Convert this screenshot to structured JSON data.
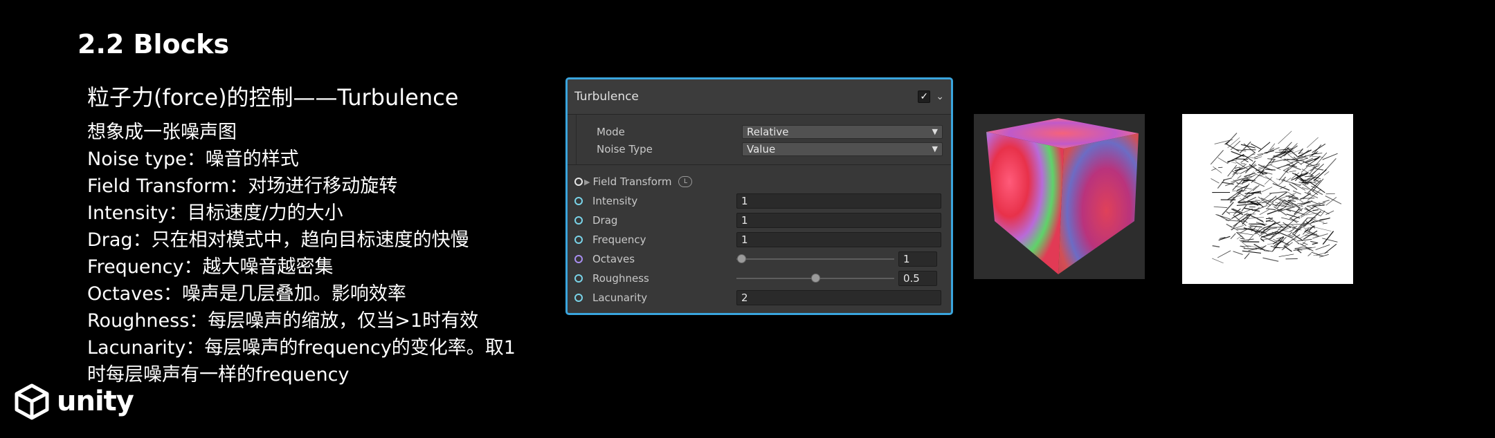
{
  "slide": {
    "title": "2.2 Blocks",
    "subtitle": "粒子力(force)的控制——Turbulence",
    "bullets": [
      "想象成一张噪声图",
      "Noise type：噪音的样式",
      "Field Transform：对场进行移动旋转",
      "Intensity：目标速度/力的大小",
      "Drag：只在相对模式中，趋向目标速度的快慢",
      "Frequency：越大噪音越密集",
      "Octaves：噪声是几层叠加。影响效率",
      "Roughness：每层噪声的缩放，仅当>1时有效",
      "Lacunarity：每层噪声的frequency的变化率。取1",
      "时每层噪声有一样的frequency"
    ],
    "logo_text": "unity"
  },
  "panel": {
    "title": "Turbulence",
    "enabled": true,
    "mode": {
      "label": "Mode",
      "value": "Relative"
    },
    "noise_type": {
      "label": "Noise Type",
      "value": "Value"
    },
    "field_transform": {
      "label": "Field Transform",
      "badge": "L"
    },
    "intensity": {
      "label": "Intensity",
      "value": "1"
    },
    "drag": {
      "label": "Drag",
      "value": "1"
    },
    "frequency": {
      "label": "Frequency",
      "value": "1"
    },
    "octaves": {
      "label": "Octaves",
      "value": "1",
      "slider_fraction": 0.03
    },
    "roughness": {
      "label": "Roughness",
      "value": "0.5",
      "slider_fraction": 0.5
    },
    "lacunarity": {
      "label": "Lacunarity",
      "value": "2"
    }
  },
  "colors": {
    "panel_border": "#3aa5de",
    "port_cyan": "#79d3e8",
    "port_purple": "#a88ef0"
  }
}
